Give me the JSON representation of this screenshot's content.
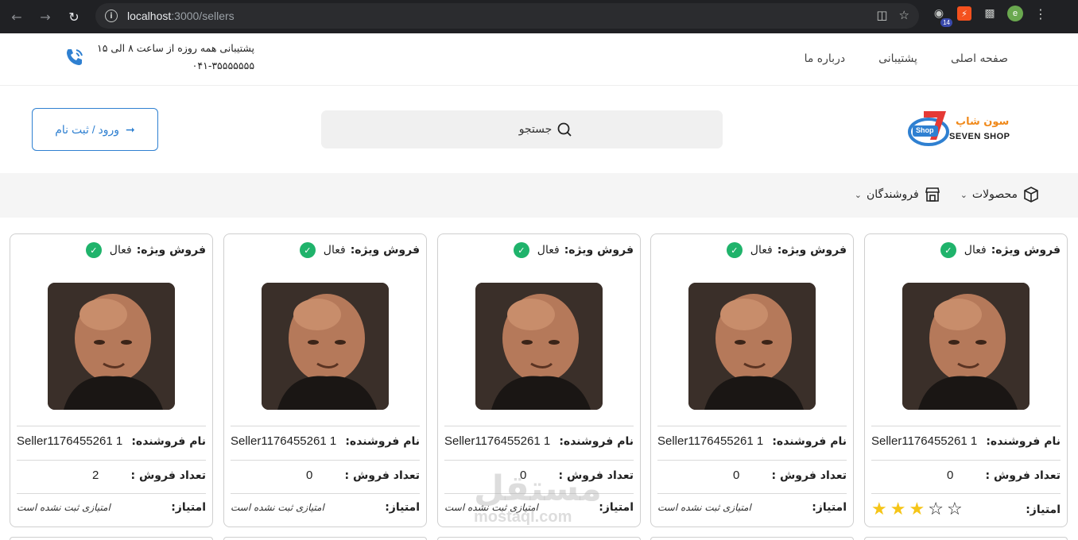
{
  "browser": {
    "url_host": "localhost",
    "url_rest": ":3000/sellers",
    "extension_badge": "14",
    "profile_letter": "e"
  },
  "topbar": {
    "nav": [
      {
        "label": "صفحه اصلی"
      },
      {
        "label": "پشتیبانی"
      },
      {
        "label": "درباره ما"
      }
    ],
    "support_hours": "پشتیبانی همه روزه از ساعت ۸ الی ۱۵",
    "support_phone": "۰۴۱-۳۵۵۵۵۵۵۵"
  },
  "header": {
    "logo_fa": "سون شاپ",
    "logo_en": "SEVEN SHOP",
    "logo_badge": "Shop",
    "search_placeholder": "جستجو",
    "login_label": "ورود / ثبت نام"
  },
  "categories": [
    {
      "label": "محصولات"
    },
    {
      "label": "فروشندگان"
    }
  ],
  "labels": {
    "special_sale": "فروش ویژه:",
    "special_sale_value": "فعال",
    "seller_name": "نام فروشنده:",
    "sales_count": "تعداد فروش :",
    "rating": "امتیاز:",
    "no_rating": "امتیازی ثبت نشده است"
  },
  "sellers": [
    {
      "name": "Seller1176455261 1",
      "sales": "0",
      "rating_stars": 3,
      "rating_max": 5,
      "has_rating": true
    },
    {
      "name": "Seller1176455261 1",
      "sales": "0",
      "has_rating": false
    },
    {
      "name": "Seller1176455261 1",
      "sales": "0",
      "has_rating": false
    },
    {
      "name": "Seller1176455261 1",
      "sales": "0",
      "has_rating": false
    },
    {
      "name": "Seller1176455261 1",
      "sales": "2",
      "has_rating": false
    }
  ],
  "watermark": {
    "fa": "مستقل",
    "en": "mostaql.com"
  },
  "colors": {
    "accent": "#2f80d1",
    "check": "#1fb36b",
    "star": "#f5c518",
    "logo_orange": "#f08a1c"
  }
}
